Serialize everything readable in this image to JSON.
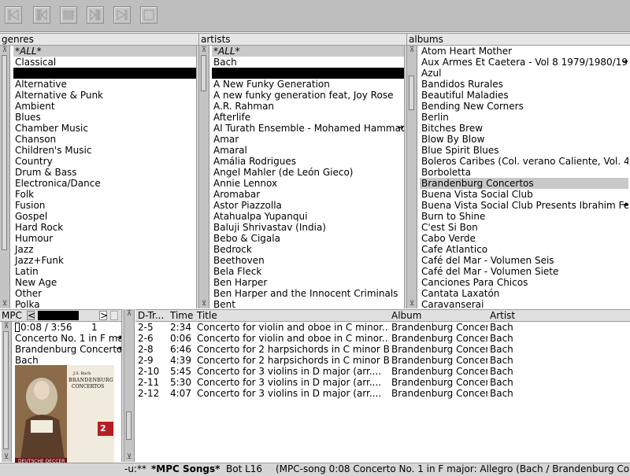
{
  "toolbar": {
    "buttons": [
      {
        "name": "first-track-icon"
      },
      {
        "name": "previous-track-icon"
      },
      {
        "name": "pause-icon"
      },
      {
        "name": "next-track-icon"
      },
      {
        "name": "last-track-icon"
      },
      {
        "name": "stop-icon"
      }
    ]
  },
  "genres": {
    "header": "genres",
    "items": [
      "*ALL*",
      "Classical",
      "",
      "Alternative",
      "Alternative & Punk",
      "Ambient",
      "Blues",
      "Chamber Music",
      "Chanson",
      "Children's Music",
      "Country",
      "Drum & Bass",
      "Electronica/Dance",
      "Folk",
      "Fusion",
      "Gospel",
      "Hard Rock",
      "Humour",
      "Jazz",
      "Jazz+Funk",
      "Latin",
      "New Age",
      "Other",
      "Polka"
    ]
  },
  "artists": {
    "header": "artists",
    "items": [
      "*ALL*",
      "Bach",
      "",
      "A New Funky Generation",
      "A new funky generation feat, Joy Rose",
      "A.R. Rahman",
      "Afterlife",
      "Al Turath Ensemble - Mohamed Hammadye",
      "Amar",
      "Amaral",
      "Amália Rodrigues",
      "Angel Mahler (de León Gieco)",
      "Annie Lennox",
      "Aromabar",
      "Astor Piazzolla",
      "Atahualpa Yupanqui",
      "Baluji Shrivastav (India)",
      "Bebo & Cigala",
      "Bedrock",
      "Beethoven",
      "Bela Fleck",
      "Ben Harper",
      "Ben Harper and the Innocent Criminals",
      "Bent"
    ]
  },
  "albums": {
    "header": "albums",
    "items": [
      "Atom Heart Mother",
      "Aux Armes Et Caetera - Vol 8 1979/1980/198",
      "Azul",
      "Bandidos Rurales",
      "Beautiful Maladies",
      "Bending New Corners",
      "Berlin",
      "Bitches Brew",
      "Blow By Blow",
      "Blue Spirit Blues",
      "Boleros Caribes (Col. verano Caliente, Vol. 4)",
      "Borboletta",
      "Brandenburg Concertos",
      "Buena Vista Social Club",
      "Buena Vista Social Club Presents Ibrahim Fer",
      "Burn to Shine",
      "C'est Si Bon",
      "Cabo Verde",
      "Cafe Atlantico",
      "Café del Mar - Volumen Seis",
      "Café del Mar - Volumen Siete",
      "Canciones Para Chicos",
      "Cantata Laxatón",
      "Caravanserai"
    ]
  },
  "player": {
    "header_label": "MPC",
    "prev_button": "<",
    "next_button": ">",
    "time": "0:08 /  3:56",
    "track_no": "1",
    "title": "Concerto No. 1 in F ma",
    "album": "Brandenburg Concertos",
    "artist": "Bach",
    "cover": {
      "line1": "J.S. Bach",
      "line2": "BRANDENBURG",
      "line3": "CONCERTOS",
      "badge": "2",
      "footer": "DEUTSCHE DECCER"
    }
  },
  "songs": {
    "columns": [
      "D-Tr...",
      "Time",
      "Title",
      "Album",
      "Artist"
    ],
    "rows": [
      {
        "track": "2-5",
        "time": "2:34",
        "title": "Concerto for violin and oboe in C minor...",
        "album": "Brandenburg Concert...",
        "artist": "Bach"
      },
      {
        "track": "2-6",
        "time": "0:06",
        "title": "Concerto for violin and oboe in C minor...",
        "album": "Brandenburg Concert...",
        "artist": "Bach"
      },
      {
        "track": "2-8",
        "time": "6:46",
        "title": "Concerto for 2 harpsichords in C minor B...",
        "album": "Brandenburg Concert...",
        "artist": "Bach"
      },
      {
        "track": "2-9",
        "time": "4:39",
        "title": "Concerto for 2 harpsichords in C minor B...",
        "album": "Brandenburg Concert...",
        "artist": "Bach"
      },
      {
        "track": "2-10",
        "time": "5:45",
        "title": "Concerto for 3 violins in D major (arr....",
        "album": "Brandenburg Concert...",
        "artist": "Bach"
      },
      {
        "track": "2-11",
        "time": "5:30",
        "title": "Concerto for 3 violins in D major (arr....",
        "album": "Brandenburg Concert...",
        "artist": "Bach"
      },
      {
        "track": "2-12",
        "time": "4:07",
        "title": "Concerto for 3 violins in D major (arr....",
        "album": "Brandenburg Concert...",
        "artist": "Bach"
      }
    ]
  },
  "modeline": {
    "prefix": "-u:**",
    "buffer": "*MPC Songs*",
    "position": "Bot L16",
    "mode": "(MPC-song  0:08 Concerto No. 1 in F major: Allegro (Bach / Brandenburg Conce"
  }
}
